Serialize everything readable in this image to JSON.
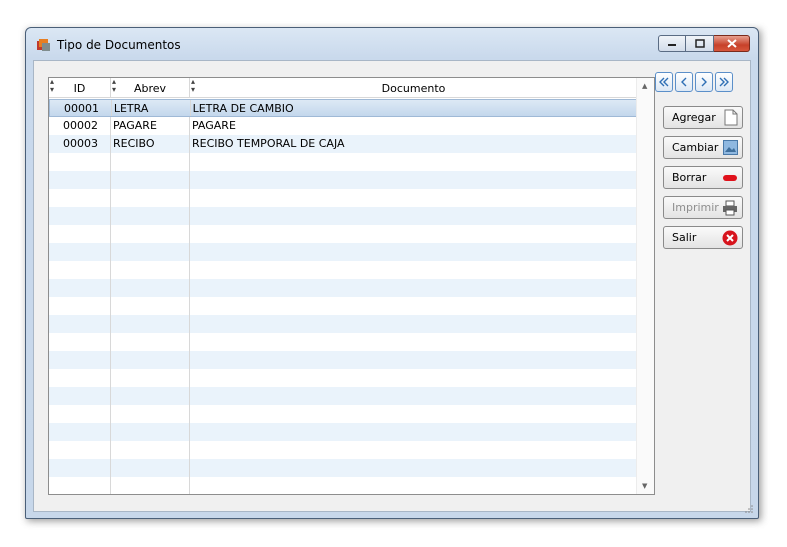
{
  "window": {
    "title": "Tipo de Documentos"
  },
  "grid": {
    "columns": [
      "ID",
      "Abrev",
      "Documento"
    ],
    "rows": [
      {
        "id": "00001",
        "abrev": "LETRA",
        "documento": "LETRA DE CAMBIO"
      },
      {
        "id": "00002",
        "abrev": "PAGARE",
        "documento": "PAGARE"
      },
      {
        "id": "00003",
        "abrev": "RECIBO",
        "documento": "RECIBO TEMPORAL DE CAJA"
      }
    ]
  },
  "buttons": {
    "agregar": "Agregar",
    "cambiar": "Cambiar",
    "borrar": "Borrar",
    "imprimir": "Imprimir",
    "salir": "Salir"
  },
  "colors": {
    "accent": "#5b8fc9",
    "close": "#c7412a",
    "selection": "#c3d7ec",
    "stripe": "#eaf3fb"
  }
}
